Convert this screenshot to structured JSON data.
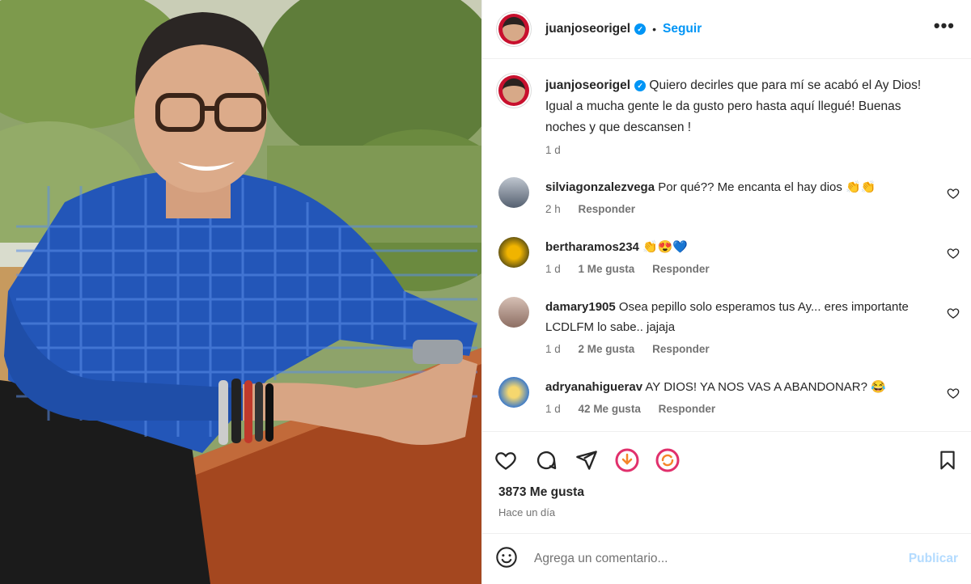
{
  "post": {
    "username": "juanjoseorigel",
    "verified_icon": "verified-badge-icon",
    "follow_label": "Seguir",
    "separator": "•",
    "more_label": "•••",
    "caption": "Quiero decirles que para mí se acabó el Ay Dios! Igual a mucha gente le da gusto pero hasta aquí llegué! Buenas noches y que descansen !",
    "caption_time": "1 d",
    "likes": "3873 Me gusta",
    "posted_ago": "Hace un día"
  },
  "comments": [
    {
      "username": "silviagonzalezvega",
      "text": "Por qué?? Me encanta el hay dios 👏👏",
      "time": "2 h",
      "likes": "",
      "reply": "Responder"
    },
    {
      "username": "bertharamos234",
      "text": "👏😍💙",
      "time": "1 d",
      "likes": "1 Me gusta",
      "reply": "Responder"
    },
    {
      "username": "damary1905",
      "text": "Osea pepillo solo esperamos tus Ay... eres importante LCDLFM lo sabe.. jajaja",
      "time": "1 d",
      "likes": "2 Me gusta",
      "reply": "Responder"
    },
    {
      "username": "adryanahiguerav",
      "text": "AY DIOS! YA NOS VAS A ABANDONAR? 😂",
      "time": "1 d",
      "likes": "42 Me gusta",
      "reply": "Responder"
    }
  ],
  "composer": {
    "placeholder": "Agrega un comentario...",
    "publish_label": "Publicar"
  },
  "colors": {
    "accent": "#0095f6",
    "publish_disabled": "#b3dbff",
    "muted": "#737373",
    "text": "#262626"
  }
}
